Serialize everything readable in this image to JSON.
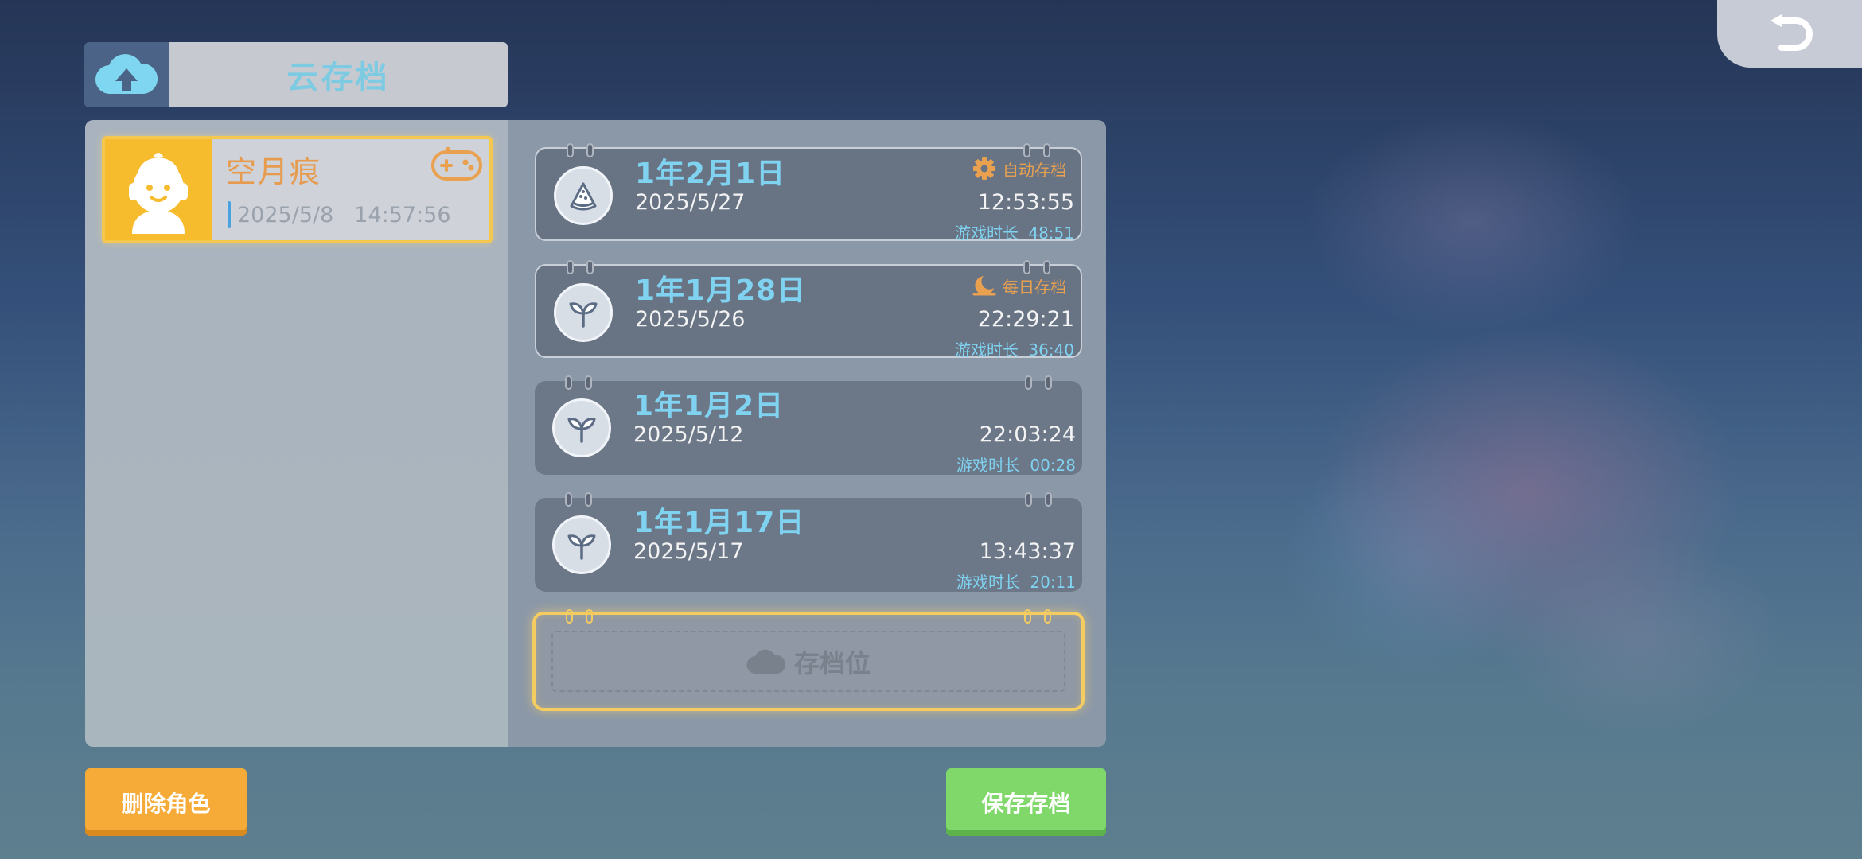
{
  "header": {
    "title": "云存档"
  },
  "character": {
    "name": "空月痕",
    "date": "2025/5/8",
    "time": "14:57:56"
  },
  "slots": [
    {
      "game_date": "1年2月1日",
      "real_date": "2025/5/27",
      "time": "12:53:55",
      "play_label": "游戏时长",
      "play_time": "48:51",
      "badge": "自动存档",
      "badge_icon": "gear-icon",
      "icon": "watermelon-icon"
    },
    {
      "game_date": "1年1月28日",
      "real_date": "2025/5/26",
      "time": "22:29:21",
      "play_label": "游戏时长",
      "play_time": "36:40",
      "badge": "每日存档",
      "badge_icon": "moon-icon",
      "icon": "sprout-icon"
    },
    {
      "game_date": "1年1月2日",
      "real_date": "2025/5/12",
      "time": "22:03:24",
      "play_label": "游戏时长",
      "play_time": "00:28",
      "icon": "sprout-icon"
    },
    {
      "game_date": "1年1月17日",
      "real_date": "2025/5/17",
      "time": "13:43:37",
      "play_label": "游戏时长",
      "play_time": "20:11",
      "icon": "sprout-icon"
    }
  ],
  "empty_slot": {
    "label": "存档位"
  },
  "buttons": {
    "delete": "删除角色",
    "save": "保存存档"
  },
  "colors": {
    "accent_blue": "#7fd2f0",
    "badge_orange": "#e9a150",
    "delete_orange": "#f6ab38",
    "save_green": "#80d86a",
    "highlight_gold": "#f4c84e"
  }
}
